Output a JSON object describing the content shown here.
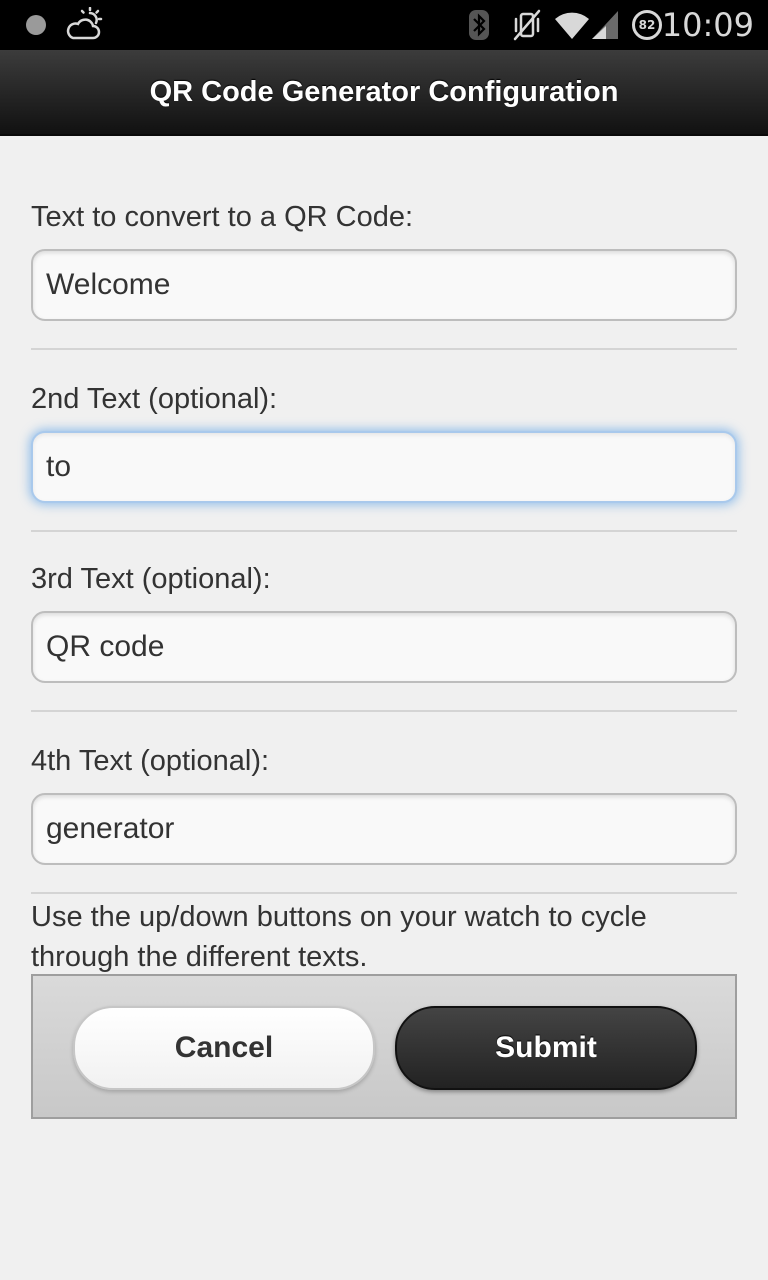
{
  "status_bar": {
    "time": "10:09",
    "battery_level": "82",
    "icons": [
      "notification-dot-icon",
      "weather-icon",
      "bluetooth-icon",
      "vibrate-off-icon",
      "wifi-icon",
      "signal-icon",
      "battery-icon"
    ]
  },
  "header": {
    "title": "QR Code Generator Configuration"
  },
  "form": {
    "fields": [
      {
        "label": "Text to convert to a QR Code:",
        "value": "Welcome"
      },
      {
        "label": "2nd Text (optional):",
        "value": "to"
      },
      {
        "label": "3rd Text (optional):",
        "value": "QR code"
      },
      {
        "label": "4th Text (optional):",
        "value": "generator"
      }
    ],
    "help_text": "Use the up/down buttons on your watch to cycle through the different texts."
  },
  "buttons": {
    "cancel_label": "Cancel",
    "submit_label": "Submit"
  },
  "colors": {
    "header_bg": "#1e1e1e",
    "focus_glow": "#5aa0e6",
    "submit_bg": "#333333",
    "page_bg": "#f0f0f0"
  }
}
